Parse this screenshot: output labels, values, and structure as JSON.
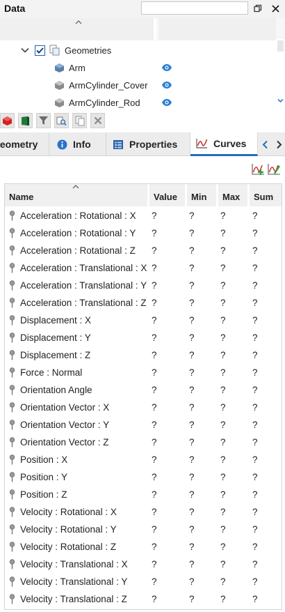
{
  "panel": {
    "title": "Data",
    "search_value": "",
    "search_placeholder": ""
  },
  "tree": {
    "root": {
      "label": "Geometries",
      "checked": true,
      "expanded": true
    },
    "items": [
      {
        "label": "Arm",
        "visible": true
      },
      {
        "label": "ArmCylinder_Cover",
        "visible": true
      },
      {
        "label": "ArmCylinder_Rod",
        "visible": true
      }
    ]
  },
  "toolbar": {
    "buttons": [
      "red-cube-icon",
      "green-book-icon",
      "filter-icon",
      "search-list-icon",
      "copy-icon",
      "delete-icon"
    ]
  },
  "tabs": [
    {
      "label": "Geometry",
      "icon": "",
      "active": false
    },
    {
      "label": "Info",
      "icon": "info-icon",
      "active": false
    },
    {
      "label": "Properties",
      "icon": "properties-icon",
      "active": false
    },
    {
      "label": "Curves",
      "icon": "curve-chart-icon",
      "active": true
    }
  ],
  "curves": {
    "actions": [
      "add-curve-icon",
      "edit-curve-icon"
    ],
    "columns": [
      "Name",
      "Value",
      "Min",
      "Max",
      "Sum"
    ],
    "rows": [
      {
        "name": "Acceleration : Rotational : X",
        "value": "?",
        "min": "?",
        "max": "?",
        "sum": "?"
      },
      {
        "name": "Acceleration : Rotational : Y",
        "value": "?",
        "min": "?",
        "max": "?",
        "sum": "?"
      },
      {
        "name": "Acceleration : Rotational : Z",
        "value": "?",
        "min": "?",
        "max": "?",
        "sum": "?"
      },
      {
        "name": "Acceleration : Translational : X",
        "value": "?",
        "min": "?",
        "max": "?",
        "sum": "?"
      },
      {
        "name": "Acceleration : Translational : Y",
        "value": "?",
        "min": "?",
        "max": "?",
        "sum": "?"
      },
      {
        "name": "Acceleration : Translational : Z",
        "value": "?",
        "min": "?",
        "max": "?",
        "sum": "?"
      },
      {
        "name": "Displacement : X",
        "value": "?",
        "min": "?",
        "max": "?",
        "sum": "?"
      },
      {
        "name": "Displacement : Y",
        "value": "?",
        "min": "?",
        "max": "?",
        "sum": "?"
      },
      {
        "name": "Displacement : Z",
        "value": "?",
        "min": "?",
        "max": "?",
        "sum": "?"
      },
      {
        "name": "Force : Normal",
        "value": "?",
        "min": "?",
        "max": "?",
        "sum": "?"
      },
      {
        "name": "Orientation Angle",
        "value": "?",
        "min": "?",
        "max": "?",
        "sum": "?"
      },
      {
        "name": "Orientation Vector : X",
        "value": "?",
        "min": "?",
        "max": "?",
        "sum": "?"
      },
      {
        "name": "Orientation Vector : Y",
        "value": "?",
        "min": "?",
        "max": "?",
        "sum": "?"
      },
      {
        "name": "Orientation Vector : Z",
        "value": "?",
        "min": "?",
        "max": "?",
        "sum": "?"
      },
      {
        "name": "Position : X",
        "value": "?",
        "min": "?",
        "max": "?",
        "sum": "?"
      },
      {
        "name": "Position : Y",
        "value": "?",
        "min": "?",
        "max": "?",
        "sum": "?"
      },
      {
        "name": "Position : Z",
        "value": "?",
        "min": "?",
        "max": "?",
        "sum": "?"
      },
      {
        "name": "Velocity : Rotational : X",
        "value": "?",
        "min": "?",
        "max": "?",
        "sum": "?"
      },
      {
        "name": "Velocity : Rotational : Y",
        "value": "?",
        "min": "?",
        "max": "?",
        "sum": "?"
      },
      {
        "name": "Velocity : Rotational : Z",
        "value": "?",
        "min": "?",
        "max": "?",
        "sum": "?"
      },
      {
        "name": "Velocity : Translational : X",
        "value": "?",
        "min": "?",
        "max": "?",
        "sum": "?"
      },
      {
        "name": "Velocity : Translational : Y",
        "value": "?",
        "min": "?",
        "max": "?",
        "sum": "?"
      },
      {
        "name": "Velocity : Translational : Z",
        "value": "?",
        "min": "?",
        "max": "?",
        "sum": "?"
      }
    ]
  },
  "colors": {
    "accent": "#1f6fbf",
    "eye": "#2b7fd4",
    "curve_red": "#d0312d",
    "curve_green": "#2e9e3e"
  }
}
